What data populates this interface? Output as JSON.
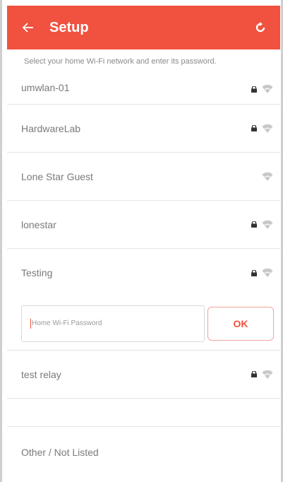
{
  "app_bar": {
    "title": "Setup",
    "accent_color": "#f0523f",
    "back_icon": "arrow-left-icon",
    "refresh_icon": "refresh-icon"
  },
  "instruction": "Select your home Wi-Fi network and enter its password.",
  "networks": [
    {
      "name": "umwlan-01",
      "locked": true
    },
    {
      "name": "HardwareLab",
      "locked": true
    },
    {
      "name": "Lone Star Guest",
      "locked": false
    },
    {
      "name": "lonestar",
      "locked": true
    },
    {
      "name": "Testing",
      "locked": true
    },
    {
      "name": "test relay",
      "locked": true
    }
  ],
  "password_field": {
    "placeholder": "Home Wi-Fi Password",
    "value": ""
  },
  "ok_button": "OK",
  "other_option": "Other / Not Listed"
}
